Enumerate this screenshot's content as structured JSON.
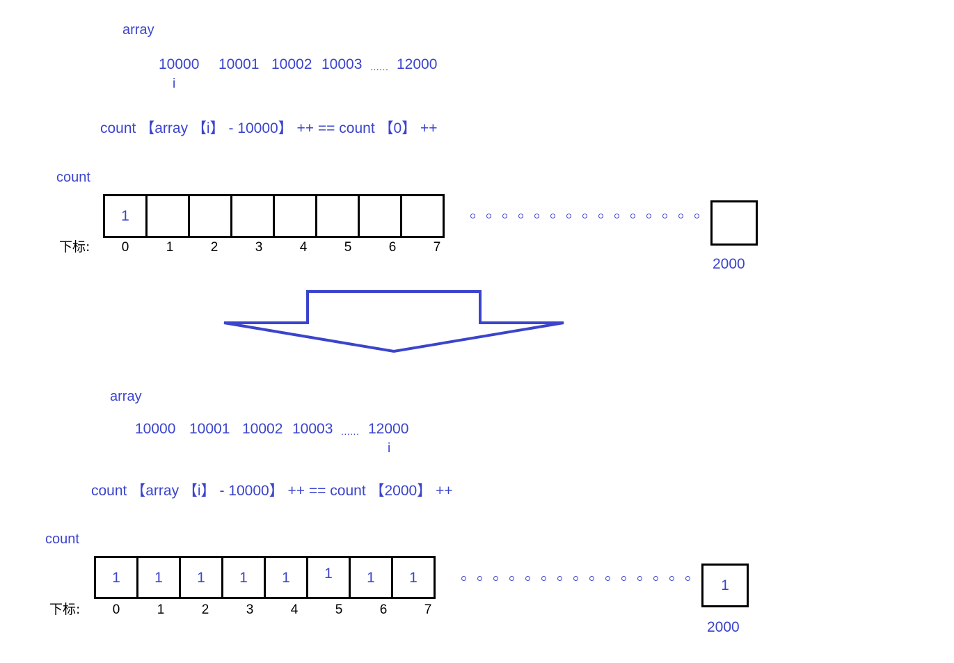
{
  "diagram": {
    "title_top_array_label": "array",
    "top": {
      "array_label": "array",
      "array_values": [
        "10000",
        "10001",
        "10002",
        "10003"
      ],
      "array_ellipsis": "......",
      "array_last_value": "12000",
      "index_marker": "i",
      "formula": {
        "part1": "count",
        "open1": "【",
        "part2": "array",
        "open2": "【",
        "part3": "i",
        "close2": "】",
        "minus": "-",
        "offset": "10000",
        "close1": "】",
        "inc1": "++",
        "eq": "==",
        "part4": "count",
        "open3": "【",
        "index": "0",
        "close3": "】",
        "inc2": "++",
        "full": "count 【array 【i】 - 10000】 ++ == count 【0】 ++"
      },
      "count_label": "count",
      "index_row_label": "下标:",
      "cells": [
        {
          "index": "0",
          "value": "1"
        },
        {
          "index": "1",
          "value": ""
        },
        {
          "index": "2",
          "value": ""
        },
        {
          "index": "3",
          "value": ""
        },
        {
          "index": "4",
          "value": ""
        },
        {
          "index": "5",
          "value": ""
        },
        {
          "index": "6",
          "value": ""
        },
        {
          "index": "7",
          "value": ""
        }
      ],
      "last_cell": {
        "index": "2000",
        "value": ""
      }
    },
    "arrow": {
      "name": "down-arrow",
      "color": "#3b44cc"
    },
    "bottom": {
      "array_label": "array",
      "array_values": [
        "10000",
        "10001",
        "10002",
        "10003"
      ],
      "array_ellipsis": "......",
      "array_last_value": "12000",
      "index_marker": "i",
      "formula": {
        "part1": "count",
        "open1": "【",
        "part2": "array",
        "open2": "【",
        "part3": "i",
        "close2": "】",
        "minus": "-",
        "offset": "10000",
        "close1": "】",
        "inc1": "++",
        "eq": "==",
        "part4": "count",
        "open3": "【",
        "index": "2000",
        "close3": "】",
        "inc2": "++",
        "full": "count 【array 【i】 - 10000】 ++ == count 【2000】 ++"
      },
      "count_label": "count",
      "index_row_label": "下标:",
      "cells": [
        {
          "index": "0",
          "value": "1"
        },
        {
          "index": "1",
          "value": "1"
        },
        {
          "index": "2",
          "value": "1"
        },
        {
          "index": "3",
          "value": "1"
        },
        {
          "index": "4",
          "value": "1"
        },
        {
          "index": "5",
          "value": "1"
        },
        {
          "index": "6",
          "value": "1"
        },
        {
          "index": "7",
          "value": "1"
        }
      ],
      "last_cell": {
        "index": "2000",
        "value": "1"
      }
    },
    "colors": {
      "accent_blue": "#3b44cc",
      "box_stroke": "#000000",
      "background": "#ffffff"
    }
  }
}
